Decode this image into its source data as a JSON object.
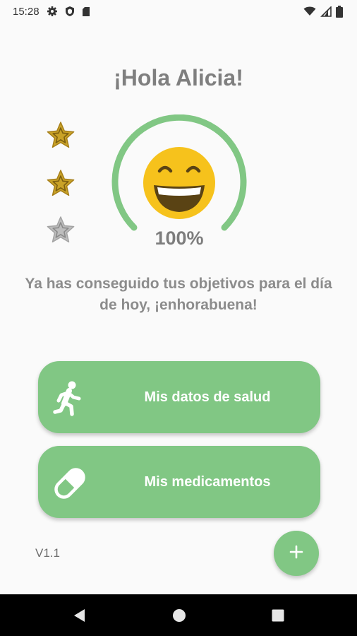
{
  "status_bar": {
    "time": "15:28",
    "left_icons": [
      "settings-icon",
      "shield-icon",
      "sd-card-icon"
    ],
    "right_icons": [
      "wifi-icon",
      "signal-icon",
      "battery-icon"
    ]
  },
  "greeting": "¡Hola Alicia!",
  "stars": [
    {
      "state": "filled",
      "color": "#c9a227"
    },
    {
      "state": "filled",
      "color": "#c9a227"
    },
    {
      "state": "empty",
      "color": "#bdbdbd"
    }
  ],
  "progress": {
    "value": 1.0,
    "label": "100%",
    "ring_color": "#81c784",
    "face_icon": "grinning-face-icon",
    "face_color": "#f6c21c"
  },
  "message": "Ya has conseguido tus objetivos para el día de hoy, ¡enhorabuena!",
  "buttons": {
    "health": {
      "label": "Mis datos de salud",
      "icon": "running-person-icon"
    },
    "meds": {
      "label": "Mis medicamentos",
      "icon": "pill-icon"
    }
  },
  "version": "V1.1",
  "fab": {
    "icon": "plus-icon"
  },
  "nav_bar": {
    "back_icon": "back-icon",
    "home_icon": "home-icon",
    "recents_icon": "recents-icon"
  },
  "colors": {
    "accent": "#81c784",
    "star_gold": "#c9a227",
    "star_gray": "#bdbdbd",
    "text_gray": "#7f7f7f",
    "background": "#fafafa"
  }
}
